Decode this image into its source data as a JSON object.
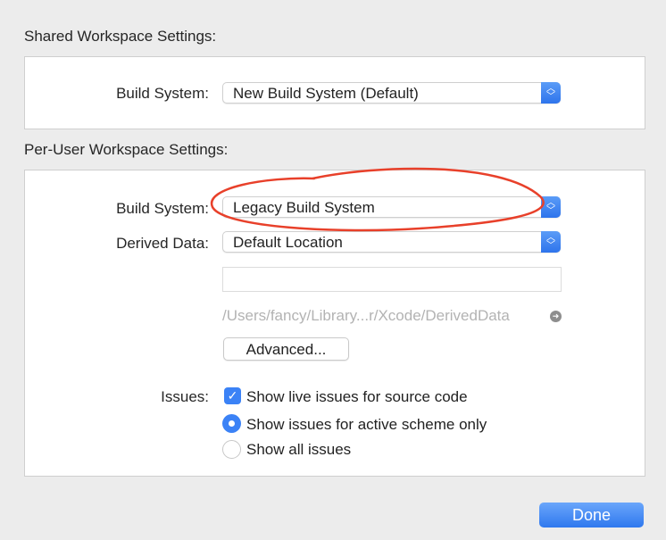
{
  "shared": {
    "title": "Shared Workspace Settings:",
    "build_system_label": "Build System:",
    "build_system_value": "New Build System (Default)"
  },
  "per_user": {
    "title": "Per-User Workspace Settings:",
    "build_system_label": "Build System:",
    "build_system_value": "Legacy Build System",
    "derived_data_label": "Derived Data:",
    "derived_data_value": "Default Location",
    "custom_path_value": "",
    "derived_path": "/Users/fancy/Library...r/Xcode/DerivedData",
    "advanced_label": "Advanced...",
    "issues_label": "Issues:",
    "live_issues_label": "Show live issues for source code",
    "live_issues_checked": true,
    "issue_scope_options": [
      "Show issues for active scheme only",
      "Show all issues"
    ],
    "issue_scope_selected": "Show issues for active scheme only"
  },
  "done_label": "Done",
  "annotation": {
    "color": "#e8402a",
    "shape": "hand-drawn ellipse around Legacy Build System"
  },
  "colors": {
    "accent": "#3b82f6"
  }
}
